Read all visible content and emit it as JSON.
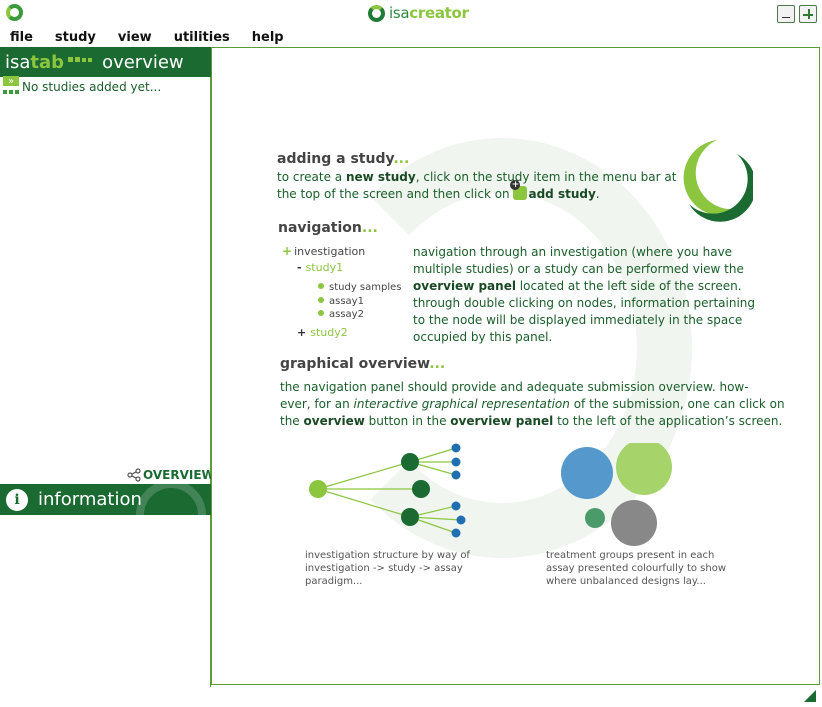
{
  "window": {
    "title_prefix": "isa",
    "title_suffix": "creator",
    "minimize_icon": "minimize-icon",
    "maximize_icon": "plus-icon"
  },
  "menu": [
    "file",
    "study",
    "view",
    "utilities",
    "help"
  ],
  "left_panel": {
    "header_brand_a": "isa",
    "header_brand_b": "tab",
    "header_title": "overview",
    "empty_text": "No studies added yet...",
    "overview_link": "OVERVIEW",
    "info_title": "information",
    "info_icon_letter": "i"
  },
  "main": {
    "add_study": {
      "title": "adding a study",
      "title_dots": "...",
      "line1_a": "to create a ",
      "line1_b": "new study",
      "line1_c": ", click on the study item in the menu bar at",
      "line2_a": "the top of the screen and then click on ",
      "line2_b": "add study",
      "line2_c": "."
    },
    "navigation": {
      "title": "navigation",
      "title_dots": "...",
      "tree": {
        "investigation": "investigation",
        "study1": "study1",
        "leaves": [
          "study samples",
          "assay1",
          "assay2"
        ],
        "study2": "study2",
        "plus": "+",
        "minus": "-"
      },
      "text_l1": "navigation through an investigation (where you have",
      "text_l2": "multiple studies) or a study can be performed view the",
      "text_l3_b": "overview panel",
      "text_l3_c": " located at the left side of the screen.",
      "text_l4": "through double clicking on nodes, information pertaining",
      "text_l5": "to the node will be displayed immediately in the space",
      "text_l6": "occupied by this panel."
    },
    "graphical": {
      "title": "graphical overview",
      "title_dots": "...",
      "l1": "the navigation panel should provide and adequate submission overview. how-",
      "l2_a": "ever, for an ",
      "l2_i": "interactive graphical representation",
      "l2_c": " of the submission, one can click on",
      "l3_a": "the ",
      "l3_b": "overview",
      "l3_c": " button in the ",
      "l3_d": "overview panel",
      "l3_e": " to the left of the application’s screen."
    },
    "caption_left": [
      "investigation structure by way of",
      "investigation -> study -> assay",
      "paradigm..."
    ],
    "caption_right": [
      "treatment groups present in each",
      "assay presented colourfully to show",
      "where unbalanced designs lay..."
    ]
  },
  "colors": {
    "brand_dark": "#1a6a32",
    "brand_light": "#8cc63f",
    "node_blue": "#1f6fb2",
    "bubble_blue": "#5599cc",
    "bubble_green": "#a6d46a",
    "bubble_teal": "#4a9a6a",
    "bubble_grey": "#888888"
  }
}
